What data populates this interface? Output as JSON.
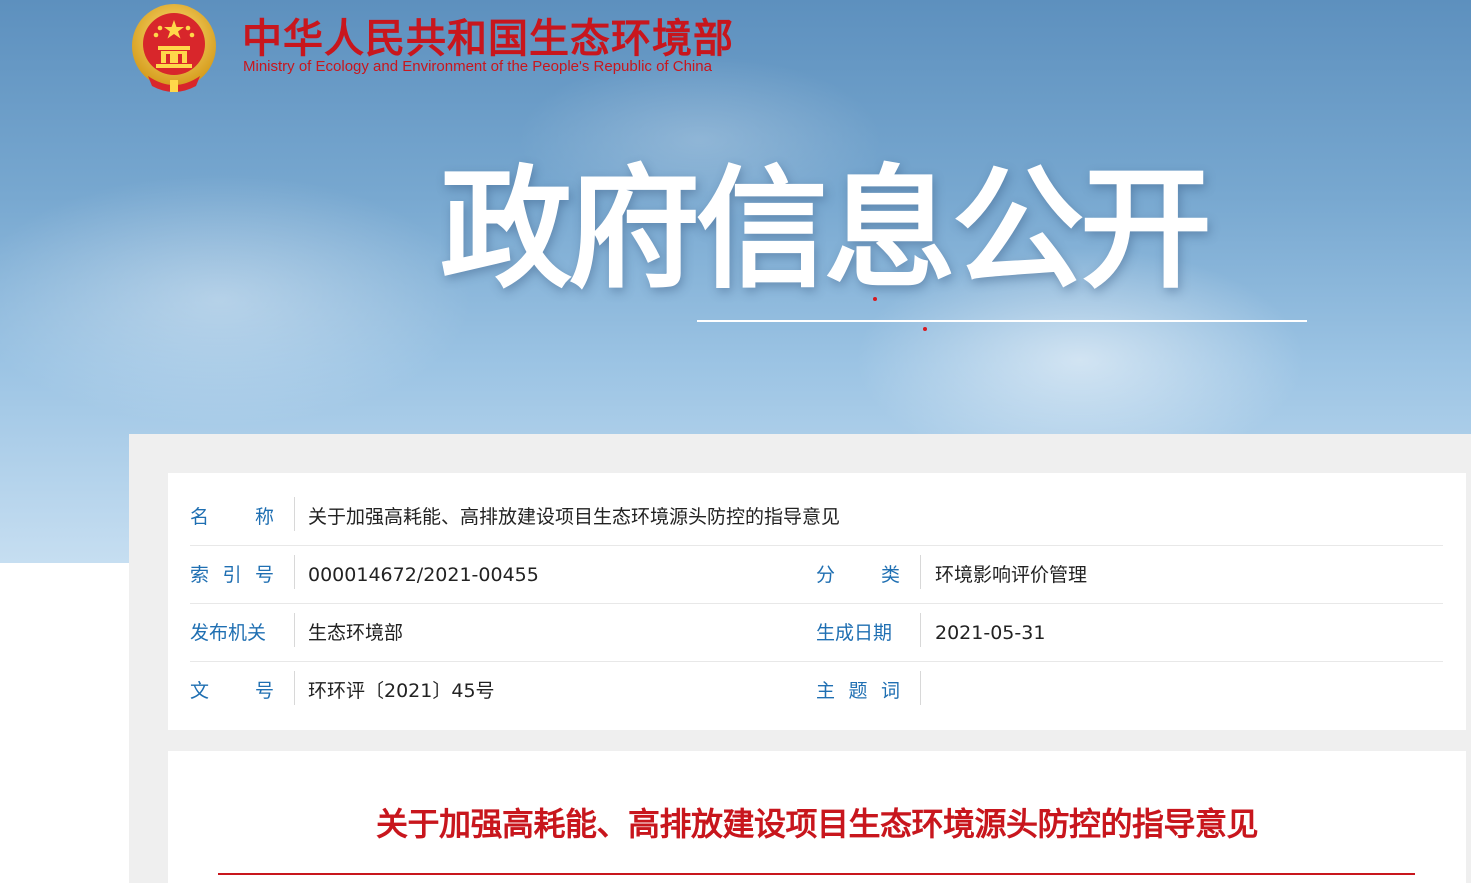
{
  "header": {
    "site_title_cn": "中华人民共和国生态环境部",
    "site_title_en": "Ministry of Ecology and Environment of the People's Republic of China",
    "emblem_icon": "national-emblem-icon",
    "brand_color": "#c8161d"
  },
  "banner": {
    "title": "政府信息公开"
  },
  "info": {
    "name_label": "名称",
    "name_value": "关于加强高耗能、高排放建设项目生态环境源头防控的指导意见",
    "index_label": "索引号",
    "index_value": "000014672/2021-00455",
    "category_label": "分类",
    "category_value": "环境影响评价管理",
    "issuer_label": "发布机关",
    "issuer_value": "生态环境部",
    "date_label": "生成日期",
    "date_value": "2021-05-31",
    "docno_label": "文号",
    "docno_value": "环环评〔2021〕45号",
    "keywords_label": "主题词",
    "keywords_value": "",
    "label_color": "#1f6fb2"
  },
  "document": {
    "title": "关于加强高耗能、高排放建设项目生态环境源头防控的指导意见"
  }
}
